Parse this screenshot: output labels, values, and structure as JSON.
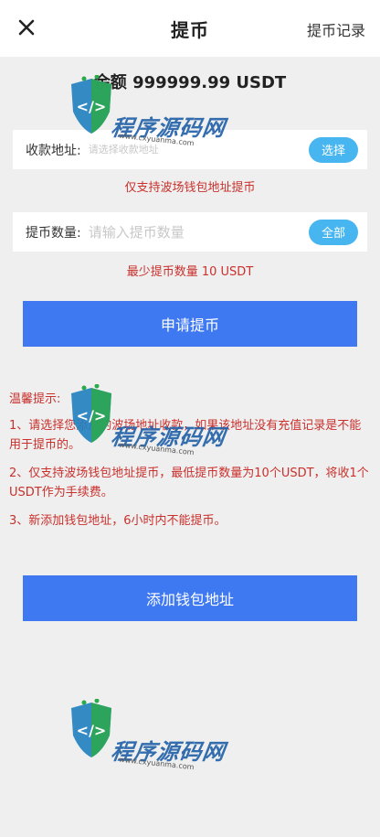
{
  "header": {
    "title": "提币",
    "history_label": "提币记录"
  },
  "balance": {
    "text": "余额 999999.99 USDT"
  },
  "address": {
    "label": "收款地址:",
    "placeholder": "请选择收款地址",
    "select_label": "选择",
    "hint": "仅支持波场钱包地址提币"
  },
  "amount": {
    "label": "提币数量:",
    "placeholder": "请输入提币数量",
    "all_label": "全部",
    "hint": "最少提币数量 10 USDT"
  },
  "submit_label": "申请提币",
  "tips": {
    "title": "温馨提示:",
    "items": [
      "1、请选择您添加的波场地址收款，如果该地址没有充值记录是不能用于提币的。",
      "2、仅支持波场钱包地址提币，最低提币数量为10个USDT，将收1个USDT作为手续费。",
      "3、新添加钱包地址，6小时内不能提币。"
    ]
  },
  "add_wallet_label": "添加钱包地址",
  "watermark": {
    "name": "程序源码网",
    "url": "www.cxyuanma.com"
  },
  "colors": {
    "primary": "#3f79f2",
    "pill": "#47b5ef",
    "danger": "#c9302c"
  }
}
